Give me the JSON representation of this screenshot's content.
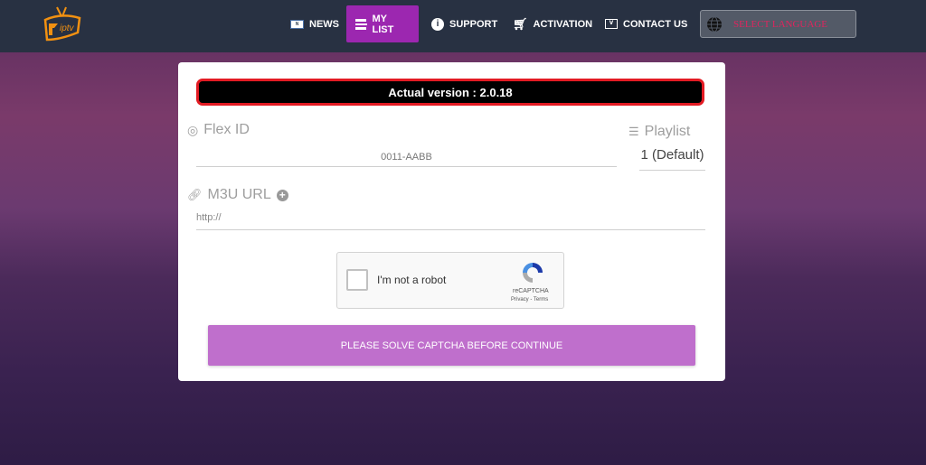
{
  "nav": {
    "logo_text": "iptv",
    "items": [
      {
        "label": "NEWS",
        "icon": "news-icon"
      },
      {
        "label": "MY LIST",
        "icon": "list-icon",
        "active": true
      },
      {
        "label": "SUPPORT",
        "icon": "info-icon"
      },
      {
        "label": "ACTIVATION",
        "icon": "cart-icon"
      },
      {
        "label": "CONTACT US",
        "icon": "mail-icon"
      }
    ],
    "language": "SELECT LANGUAGE"
  },
  "form": {
    "version": "Actual version : 2.0.18",
    "flex_id_label": "Flex ID",
    "flex_id_value": "0011-AABB",
    "playlist_label": "Playlist",
    "playlist_value": "1 (Default)",
    "m3u_label": "M3U URL",
    "m3u_placeholder": "http://",
    "captcha": {
      "label": "I'm not a robot",
      "brand": "reCAPTCHA",
      "links": "Privacy - Terms"
    },
    "submit": "PLEASE SOLVE CAPTCHA BEFORE CONTINUE"
  },
  "colors": {
    "nav_bg": "#283142",
    "accent": "#9c27b0",
    "button": "#bf6fcc",
    "version_border": "#e31b23"
  }
}
